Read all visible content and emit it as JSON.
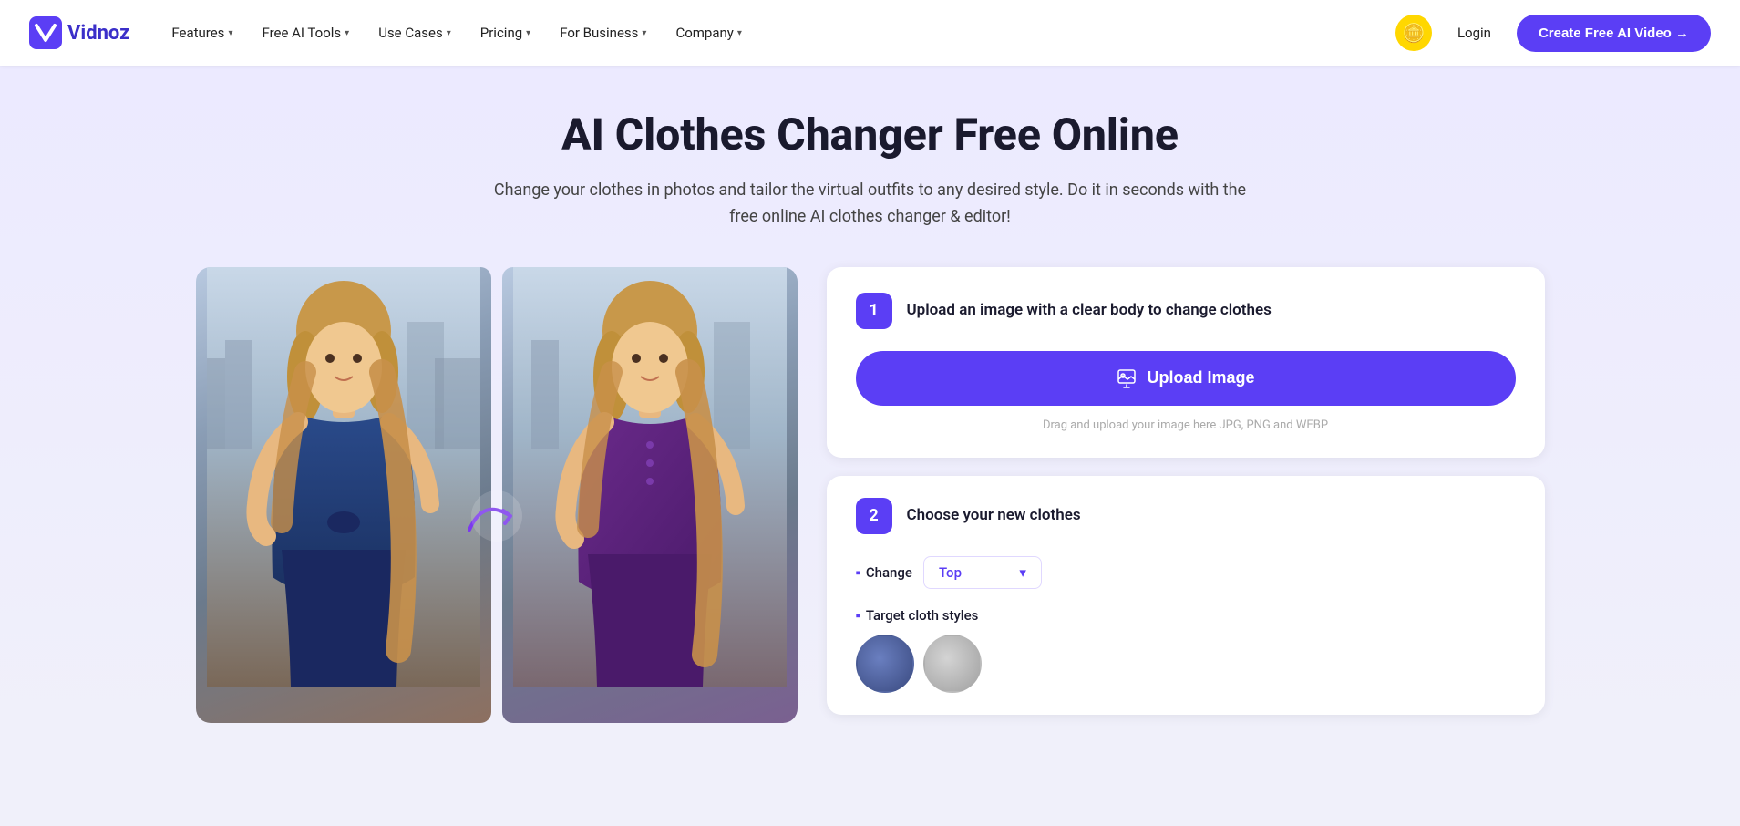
{
  "brand": {
    "name": "Vidnoz",
    "logo_initial": "V"
  },
  "nav": {
    "links": [
      {
        "label": "Features",
        "has_dropdown": true
      },
      {
        "label": "Free AI Tools",
        "has_dropdown": true
      },
      {
        "label": "Use Cases",
        "has_dropdown": true
      },
      {
        "label": "Pricing",
        "has_dropdown": true
      },
      {
        "label": "For Business",
        "has_dropdown": true
      },
      {
        "label": "Company",
        "has_dropdown": true
      }
    ],
    "login_label": "Login",
    "cta_label": "Create Free AI Video →"
  },
  "hero": {
    "title": "AI Clothes Changer Free Online",
    "subtitle": "Change your clothes in photos and tailor the virtual outfits to any desired style. Do it in seconds with the free online AI clothes changer & editor!"
  },
  "step1": {
    "badge": "1",
    "title": "Upload an image with a clear body to change clothes",
    "upload_btn_label": "Upload Image",
    "upload_hint": "Drag and upload your image here JPG, PNG and WEBP"
  },
  "step2": {
    "badge": "2",
    "title": "Choose your new clothes",
    "change_label": "Change",
    "dropdown_value": "Top",
    "target_label": "Target cloth styles"
  }
}
